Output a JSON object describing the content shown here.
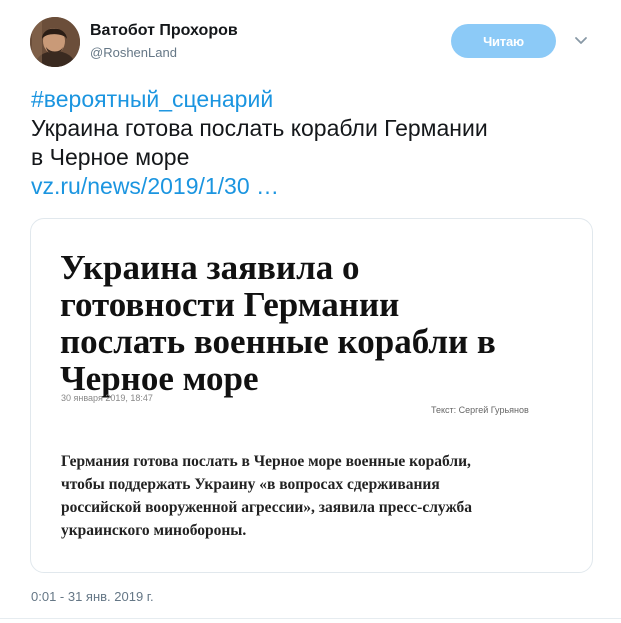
{
  "user": {
    "display_name": "Ватобот Прохоров",
    "handle": "@RoshenLand",
    "avatar_icon": "user-avatar-photo"
  },
  "follow_button": {
    "label": "Читаю",
    "color": "#8ccaf7"
  },
  "tweet": {
    "hashtag": "#вероятный_сценарий",
    "text_lines": [
      "Украина готова послать корабли Германии",
      "в Черное море"
    ],
    "link": "vz.ru/news/2019/1/30 …",
    "timestamp": "0:01 - 31 янв. 2019 г.",
    "link_color": "#1b95e0"
  },
  "card": {
    "headline_lines": [
      "Украина заявила о",
      "готовности Германии",
      "послать военные корабли в",
      "Черное море"
    ],
    "date": "30 января 2019, 18:47",
    "author": "Текст: Сергей Гурьянов",
    "lead_lines": [
      "Германия готова послать в Черное море военные корабли,",
      "чтобы поддержать Украину «в вопросах сдерживания",
      "российской вооруженной агрессии», заявила пресс-служба",
      "украинского минобороны."
    ]
  },
  "icons": {
    "caret": "chevron-down-icon"
  }
}
